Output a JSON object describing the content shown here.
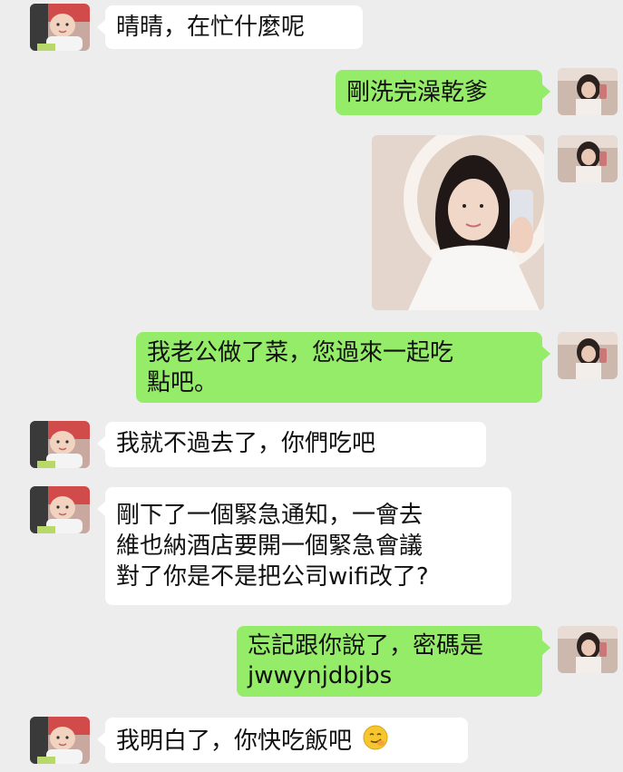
{
  "chat": {
    "messages": [
      {
        "side": "left",
        "text": "晴晴，在忙什麼呢"
      },
      {
        "side": "right",
        "text": "剛洗完澡乾爹"
      },
      {
        "side": "right",
        "type": "image",
        "image": "selfie-photo"
      },
      {
        "side": "right",
        "lines": [
          "我老公做了菜，您過來一起吃",
          "點吧。"
        ]
      },
      {
        "side": "left",
        "text": "我就不過去了，你們吃吧"
      },
      {
        "side": "left",
        "lines": [
          "剛下了一個緊急通知，一會去",
          "維也納酒店要開一個緊急會議",
          "對了你是不是把公司wifi改了?"
        ]
      },
      {
        "side": "right",
        "lines": [
          "忘記跟你說了，密碼是",
          "jwwynjdbjbs"
        ]
      },
      {
        "side": "left",
        "text": "我明白了，你快吃飯吧",
        "emoji": "smirk-emoji"
      }
    ]
  },
  "colors": {
    "background": "#ededed",
    "sent_bubble": "#95ec69",
    "received_bubble": "#ffffff",
    "text": "#111111"
  }
}
